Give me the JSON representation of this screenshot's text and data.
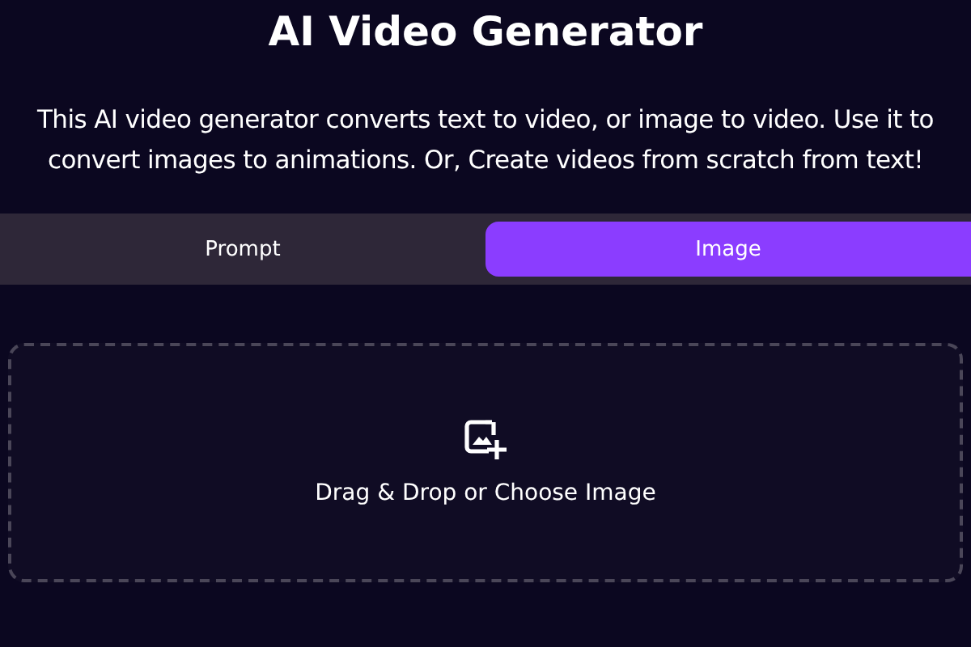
{
  "title": "AI Video Generator",
  "description": "This AI video generator converts text to video, or image to video. Use it to convert images to animations. Or, Create videos from scratch from text!",
  "tabs": [
    {
      "label": "Prompt",
      "selected": false
    },
    {
      "label": "Image",
      "selected": true
    }
  ],
  "dropzone": {
    "label": "Drag & Drop or Choose Image"
  }
}
